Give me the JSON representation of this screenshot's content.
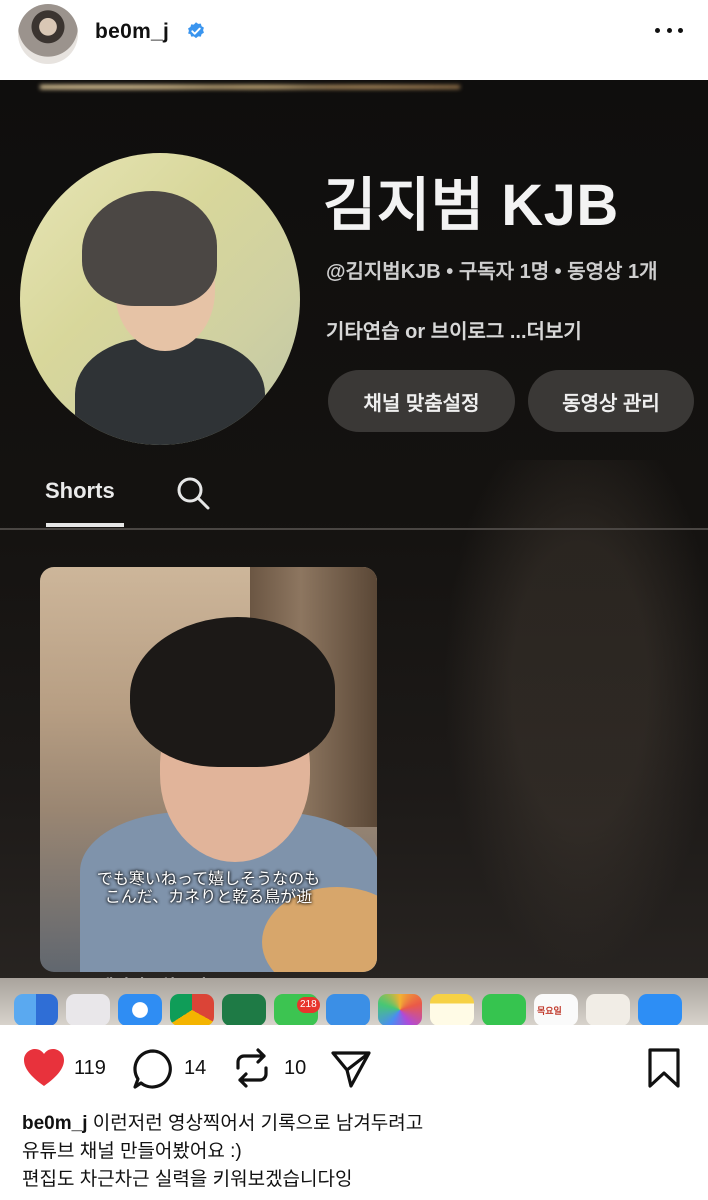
{
  "post": {
    "username": "be0m_j",
    "verified_icon": "verified-badge-icon",
    "more_icon": "more-horizontal-icon"
  },
  "screen": {
    "channel_name": "김지범 KJB",
    "channel_meta": "@김지범KJB • 구독자 1명 • 동영상 1개",
    "channel_desc": "기타연습 or 브이로그 ...더보기",
    "customize_button": "채널 맞춤설정",
    "manage_button": "동영상 관리",
    "tab_shorts": "Shorts",
    "shorts_subtitle_line1": "でも寒いねって嬉しそうなのも",
    "shorts_subtitle_line2": "こんだ、カネりと乾る鳥が逝",
    "shorts_caption": "백년범 - 최종의 cover",
    "dock_badge": "218",
    "dock_calendar": "목요일"
  },
  "actions": {
    "like_count": "119",
    "comment_count": "14",
    "repost_count": "10",
    "like_color": "#e8323c"
  },
  "caption": {
    "username": "be0m_j",
    "line1": "이런저런 영상찍어서 기록으로 남겨두려고",
    "line2": "유튜브 채널 만들어봤어요 :)",
    "line3": "편집도 차근차근 실력을 키워보겠습니다잉"
  }
}
